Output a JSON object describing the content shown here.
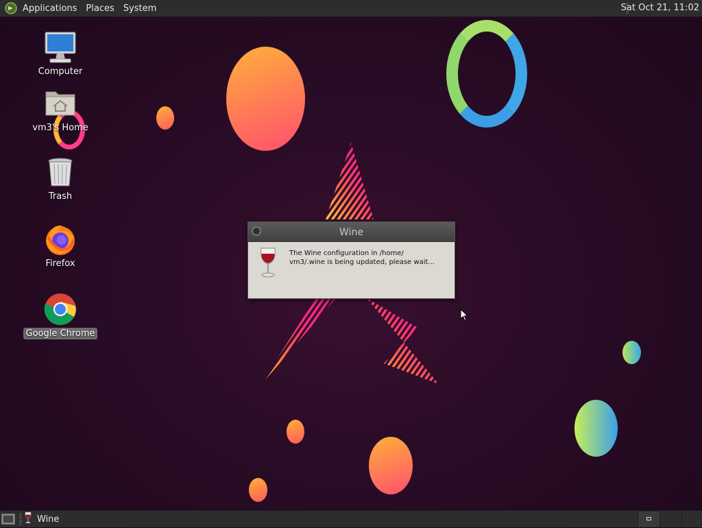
{
  "top_panel": {
    "menus": [
      "Applications",
      "Places",
      "System"
    ],
    "clock": "Sat Oct 21, 11:02"
  },
  "desktop_icons": [
    {
      "label": "Computer",
      "icon": "computer-icon"
    },
    {
      "label": "vm3's Home",
      "icon": "home-folder-icon"
    },
    {
      "label": "Trash",
      "icon": "trash-icon"
    },
    {
      "label": "Firefox",
      "icon": "firefox-icon"
    },
    {
      "label": "Google Chrome",
      "icon": "chrome-icon",
      "selected": true
    }
  ],
  "dialog": {
    "title": "Wine",
    "message_line1": "The Wine configuration in /home/",
    "message_line2": "vm3/.wine is being updated, please wait...",
    "icon": "wine-glass-icon"
  },
  "bottom_panel": {
    "task_label": "Wine",
    "task_icon": "wine-glass-icon"
  }
}
